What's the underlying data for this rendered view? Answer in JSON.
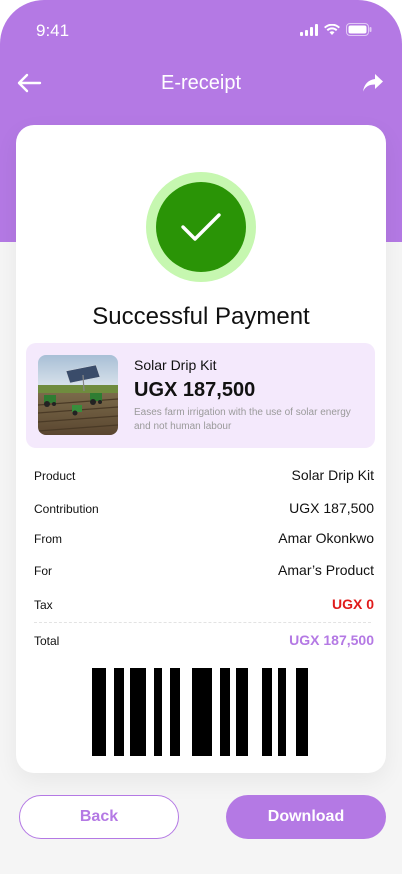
{
  "status_bar": {
    "time": "9:41"
  },
  "header": {
    "title": "E-receipt",
    "back_icon": "arrow-left-icon",
    "share_icon": "share-forward-icon"
  },
  "receipt": {
    "status_icon": "checkmark-icon",
    "status_title": "Successful Payment",
    "product": {
      "name": "Solar Drip Kit",
      "price": "UGX 187,500",
      "description": "Eases farm irrigation with the use of solar energy and not human labour"
    },
    "details": [
      {
        "label": "Product",
        "value": "Solar Drip Kit"
      },
      {
        "label": "Contribution",
        "value": "UGX 187,500"
      },
      {
        "label": "From",
        "value": "Amar Okonkwo"
      },
      {
        "label": "For",
        "value": "Amar’s Product"
      },
      {
        "label": "Tax",
        "value": "UGX 0"
      }
    ],
    "total": {
      "label": "Total",
      "value": "UGX 187,500"
    }
  },
  "actions": {
    "back_label": "Back",
    "download_label": "Download"
  },
  "colors": {
    "accent": "#b479e4",
    "success": "#2a9406",
    "tax": "#e01b1b"
  }
}
